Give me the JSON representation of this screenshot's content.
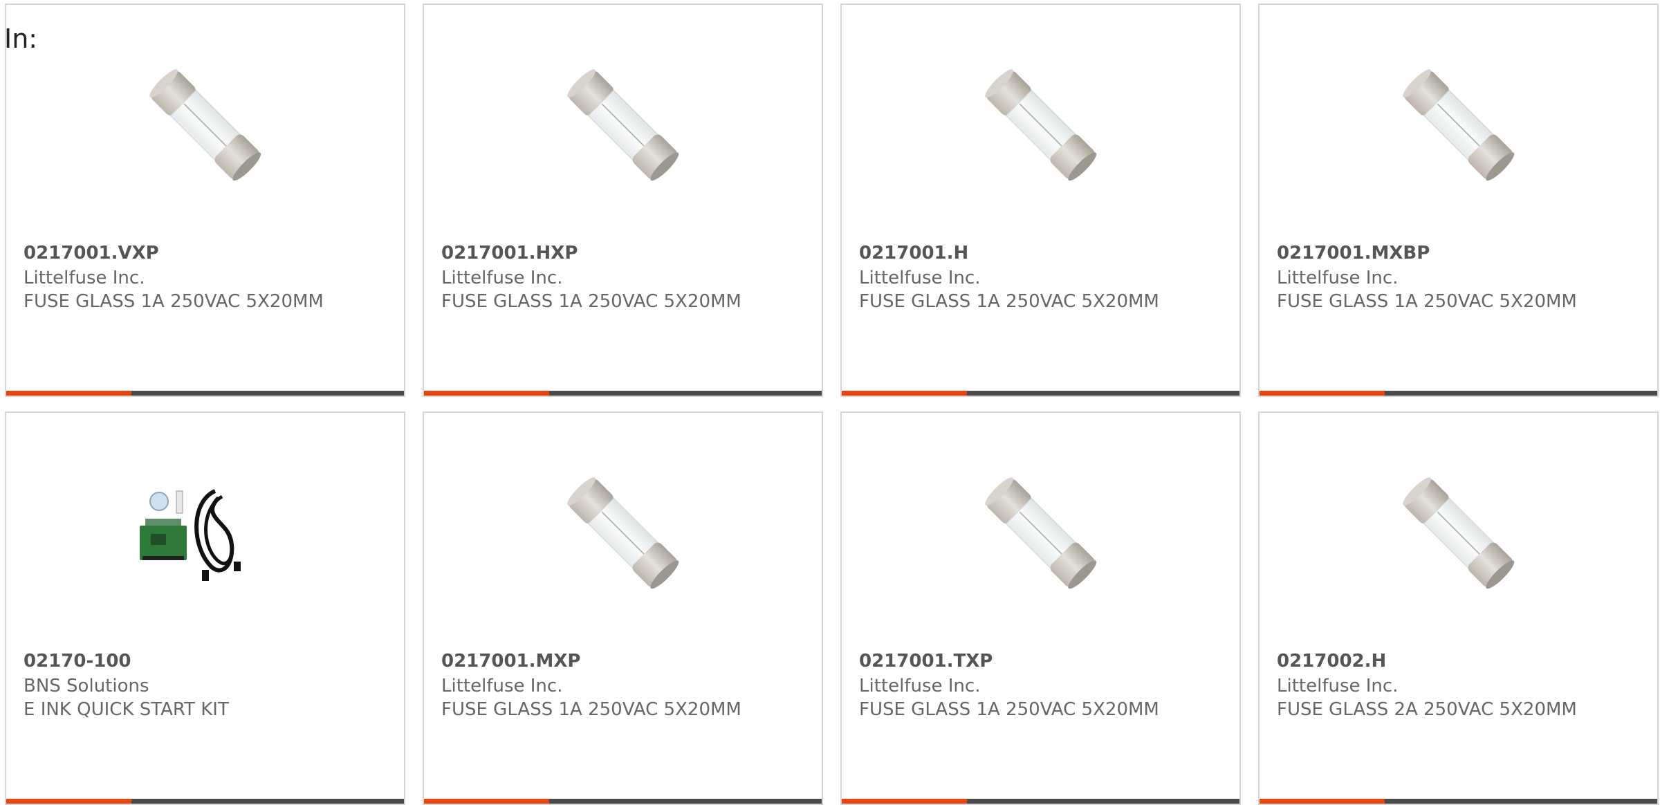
{
  "filter_label": "In:",
  "colors": {
    "accent": "#e8440f",
    "bar": "#4a4a4a",
    "border": "#d6d6d6"
  },
  "products": [
    {
      "part": "0217001.VXP",
      "manufacturer": "Littelfuse Inc.",
      "description": "FUSE GLASS 1A 250VAC 5X20MM",
      "image": "fuse-image"
    },
    {
      "part": "0217001.HXP",
      "manufacturer": "Littelfuse Inc.",
      "description": "FUSE GLASS 1A 250VAC 5X20MM",
      "image": "fuse-image"
    },
    {
      "part": "0217001.H",
      "manufacturer": "Littelfuse Inc.",
      "description": "FUSE GLASS 1A 250VAC 5X20MM",
      "image": "fuse-image"
    },
    {
      "part": "0217001.MXBP",
      "manufacturer": "Littelfuse Inc.",
      "description": "FUSE GLASS 1A 250VAC 5X20MM",
      "image": "fuse-image"
    },
    {
      "part": "02170-100",
      "manufacturer": "BNS Solutions",
      "description": "E INK QUICK START KIT",
      "image": "kit-image"
    },
    {
      "part": "0217001.MXP",
      "manufacturer": "Littelfuse Inc.",
      "description": "FUSE GLASS 1A 250VAC 5X20MM",
      "image": "fuse-image"
    },
    {
      "part": "0217001.TXP",
      "manufacturer": "Littelfuse Inc.",
      "description": "FUSE GLASS 1A 250VAC 5X20MM",
      "image": "fuse-image"
    },
    {
      "part": "0217002.H",
      "manufacturer": "Littelfuse Inc.",
      "description": "FUSE GLASS 2A 250VAC 5X20MM",
      "image": "fuse-image"
    }
  ]
}
